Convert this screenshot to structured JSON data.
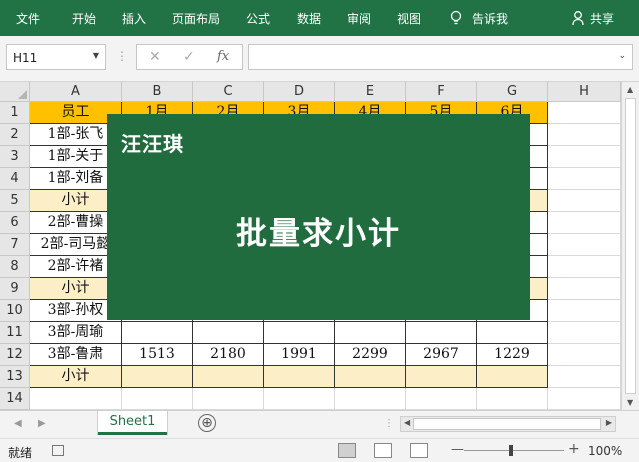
{
  "ribbon": {
    "tabs": [
      "文件",
      "开始",
      "插入",
      "页面布局",
      "公式",
      "数据",
      "审阅",
      "视图"
    ],
    "tell_me": "告诉我",
    "share": "共享"
  },
  "formula_bar": {
    "name_box": "H11",
    "cancel": "✕",
    "enter": "✓",
    "fx": "fx",
    "formula": ""
  },
  "columns": [
    "A",
    "B",
    "C",
    "D",
    "E",
    "F",
    "G",
    "H"
  ],
  "rows": [
    "1",
    "2",
    "3",
    "4",
    "5",
    "6",
    "7",
    "8",
    "9",
    "10",
    "11",
    "12",
    "13",
    "14"
  ],
  "cells": [
    [
      "员工",
      "1月",
      "2月",
      "3月",
      "4月",
      "5月",
      "6月",
      ""
    ],
    [
      "1部-张飞",
      "",
      "",
      "",
      "",
      "",
      "",
      ""
    ],
    [
      "1部-关于",
      "",
      "",
      "",
      "",
      "",
      "",
      ""
    ],
    [
      "1部-刘备",
      "",
      "",
      "",
      "",
      "",
      "",
      ""
    ],
    [
      "小计",
      "",
      "",
      "",
      "",
      "",
      "",
      ""
    ],
    [
      "2部-曹操",
      "",
      "",
      "",
      "",
      "",
      "",
      ""
    ],
    [
      "2部-司马懿",
      "",
      "",
      "",
      "",
      "",
      "",
      ""
    ],
    [
      "2部-许褚",
      "",
      "",
      "",
      "",
      "",
      "",
      ""
    ],
    [
      "小计",
      "",
      "",
      "",
      "",
      "",
      "",
      ""
    ],
    [
      "3部-孙权",
      "",
      "",
      "",
      "",
      "",
      "",
      ""
    ],
    [
      "3部-周瑜",
      "",
      "",
      "",
      "",
      "",
      "",
      ""
    ],
    [
      "3部-鲁肃",
      "1513",
      "2180",
      "1991",
      "2299",
      "2967",
      "1229",
      ""
    ],
    [
      "小计",
      "",
      "",
      "",
      "",
      "",
      "",
      ""
    ],
    [
      "",
      "",
      "",
      "",
      "",
      "",
      "",
      ""
    ]
  ],
  "banner": {
    "brand": "汪汪琪",
    "title": "批量求小计"
  },
  "sheets": {
    "active": "Sheet1",
    "add": "⊕"
  },
  "status": {
    "ready": "就绪",
    "zoom": "100%"
  },
  "colors": {
    "ribbon": "#217346",
    "header_fill": "#ffc000",
    "subtotal_fill": "#fcefc8",
    "banner": "#206c3f"
  }
}
